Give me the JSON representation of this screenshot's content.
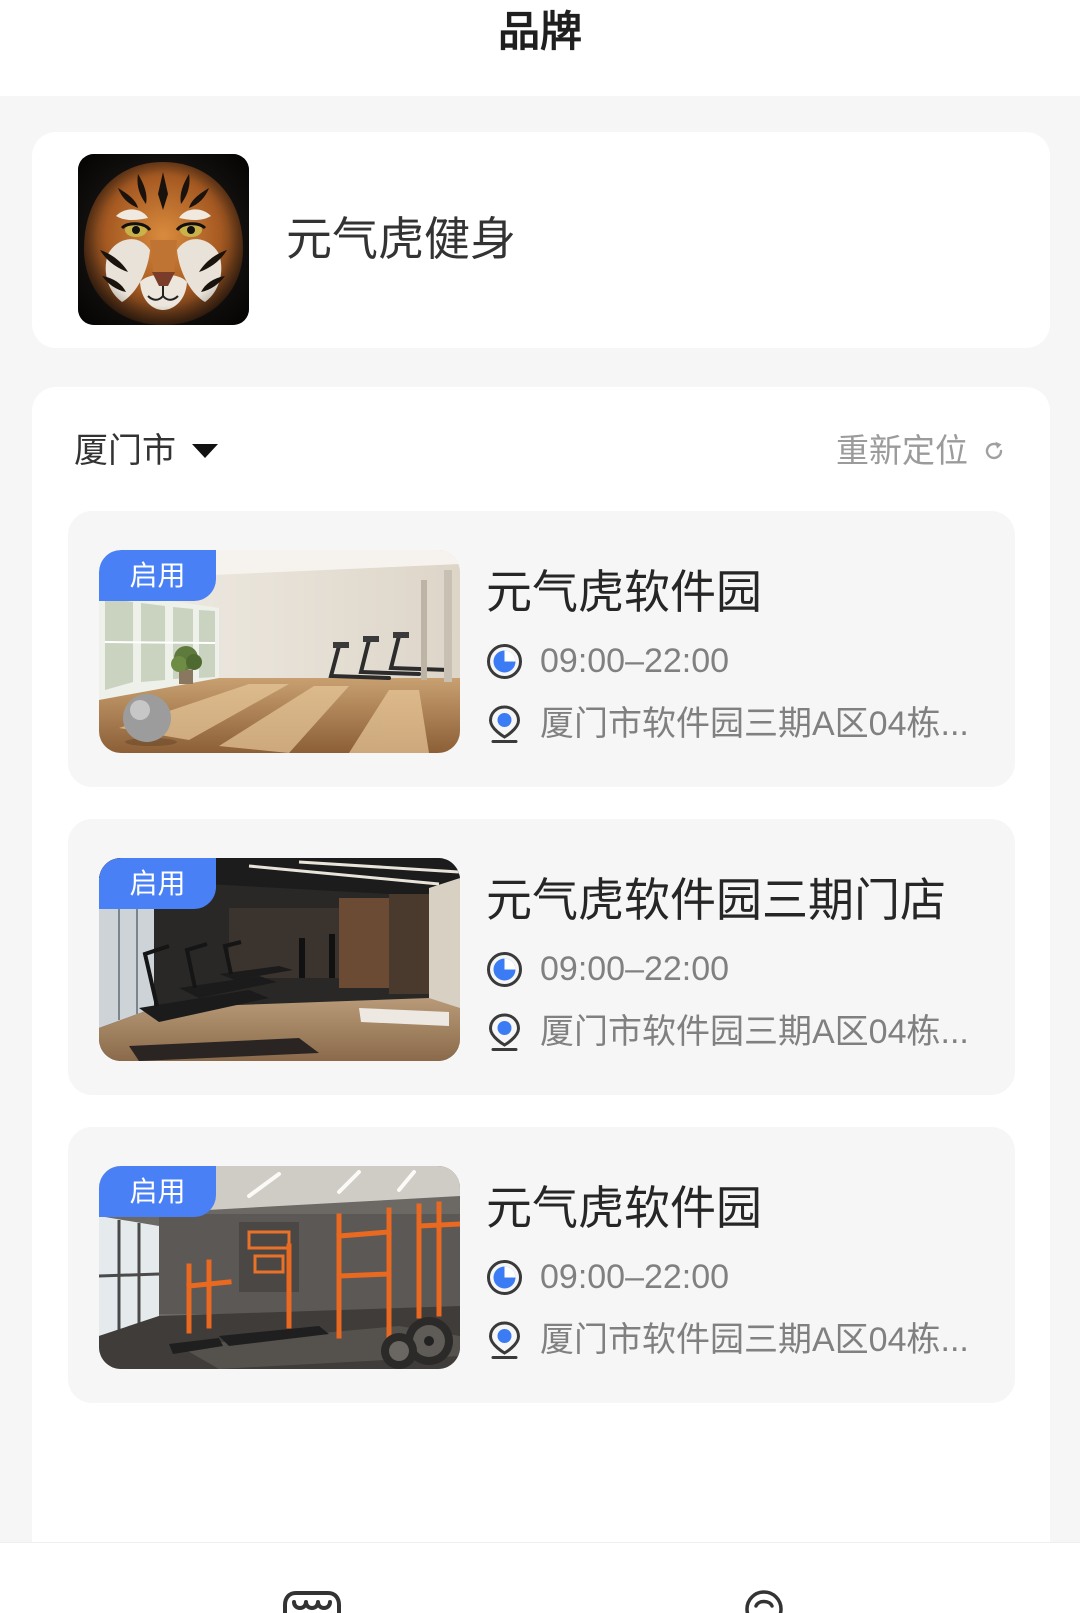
{
  "header": {
    "title": "品牌"
  },
  "brand": {
    "name": "元气虎健身",
    "logo": "tiger-logo"
  },
  "location": {
    "city": "厦门市",
    "city_dropdown_icon": "caret-down-icon",
    "relocate_label": "重新定位",
    "relocate_icon": "refresh-icon"
  },
  "store_icons": {
    "hours": "clock-icon",
    "address": "location-pin-icon"
  },
  "stores": [
    {
      "name": "元气虎软件园",
      "status": "启用",
      "hours": "09:00–22:00",
      "address": "厦门市软件园三期A区04栋..."
    },
    {
      "name": "元气虎软件园三期门店",
      "status": "启用",
      "hours": "09:00–22:00",
      "address": "厦门市软件园三期A区04栋..."
    },
    {
      "name": "元气虎软件园",
      "status": "启用",
      "hours": "09:00–22:00",
      "address": "厦门市软件园三期A区04栋..."
    }
  ],
  "tabbar": {
    "items": [
      {
        "icon": "shop-icon"
      },
      {
        "icon": "smile-icon"
      }
    ]
  },
  "colors": {
    "accent": "#4a80f5",
    "text_primary": "#262626",
    "text_secondary": "#808080",
    "page_background": "#f6f6f6",
    "card_background": "#ffffff"
  }
}
